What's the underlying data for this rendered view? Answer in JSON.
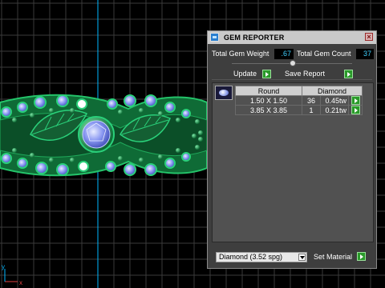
{
  "panel": {
    "title": "GEM REPORTER",
    "close_symbol": "×",
    "total_weight_label": "Total Gem Weight",
    "total_weight_value": ".67",
    "total_count_label": "Total Gem Count",
    "total_count_value": "37",
    "update_label": "Update",
    "save_report_label": "Save Report",
    "table": {
      "headers": [
        "Round",
        "Diamond"
      ],
      "rows": [
        {
          "size": "1.50 X 1.50",
          "count": "36",
          "weight": "0.45tw"
        },
        {
          "size": "3.85 X 3.85",
          "count": "1",
          "weight": "0.21tw"
        }
      ]
    },
    "material_value": "Diamond   (3.52 spg)",
    "set_material_label": "Set Material"
  },
  "viewport": {
    "axis_x_label": "x",
    "axis_y_label": "y",
    "colors": {
      "grid": "#3a3a3a",
      "ring_green": "#1fa85a",
      "gem_blue": "#7f8ef0",
      "axis_cyan": "#00b7ff"
    }
  },
  "icons": [
    "gem-reporter-icon",
    "close-icon",
    "slider-knob-icon",
    "play-icon",
    "gem-thumbnail-icon",
    "dropdown-arrow-icon"
  ]
}
